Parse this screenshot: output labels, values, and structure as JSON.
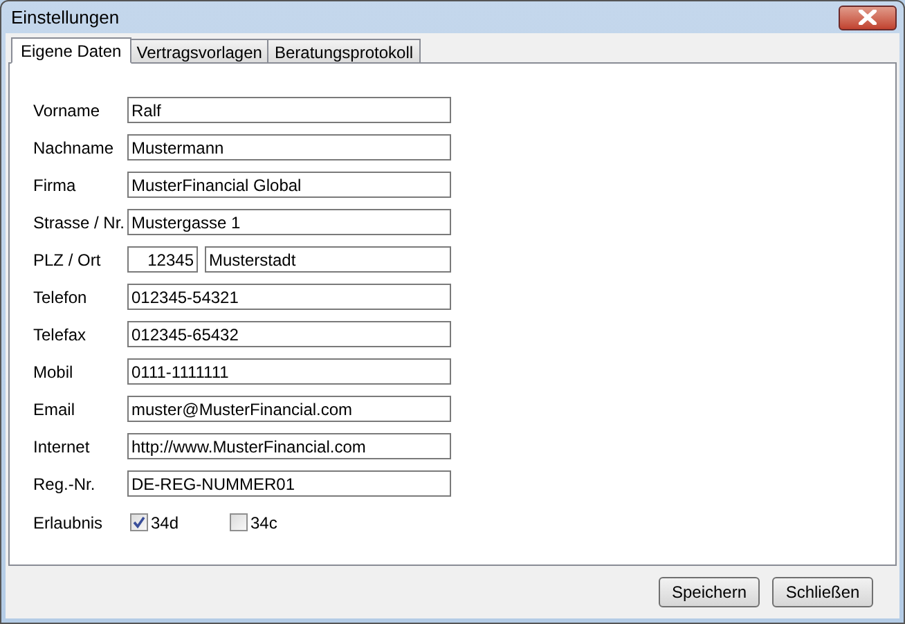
{
  "window": {
    "title": "Einstellungen"
  },
  "tabs": [
    {
      "label": "Eigene Daten",
      "selected": true
    },
    {
      "label": "Vertragsvorlagen",
      "selected": false
    },
    {
      "label": "Beratungsprotokoll",
      "selected": false
    }
  ],
  "fields": [
    {
      "label": "Vorname",
      "values": [
        "Ralf"
      ]
    },
    {
      "label": "Nachname",
      "values": [
        "Mustermann"
      ]
    },
    {
      "label": "Firma",
      "values": [
        "MusterFinancial Global"
      ]
    },
    {
      "label": "Strasse / Nr.",
      "values": [
        "Mustergasse 1"
      ]
    },
    {
      "label": "PLZ / Ort",
      "values": [
        "12345",
        "Musterstadt"
      ]
    },
    {
      "label": "Telefon",
      "values": [
        "012345-54321"
      ]
    },
    {
      "label": "Telefax",
      "values": [
        "012345-65432"
      ]
    },
    {
      "label": "Mobil",
      "values": [
        "0111-1111111"
      ]
    },
    {
      "label": "Email",
      "values": [
        "muster@MusterFinancial.com"
      ]
    },
    {
      "label": "Internet",
      "values": [
        "http://www.MusterFinancial.com"
      ]
    },
    {
      "label": "Reg.-Nr.",
      "values": [
        "DE-REG-NUMMER01"
      ]
    }
  ],
  "permission": {
    "label": "Erlaubnis",
    "options": [
      {
        "label": "34d",
        "checked": true
      },
      {
        "label": "34c",
        "checked": false
      }
    ]
  },
  "buttons": [
    "Speichern",
    "Schließen"
  ]
}
